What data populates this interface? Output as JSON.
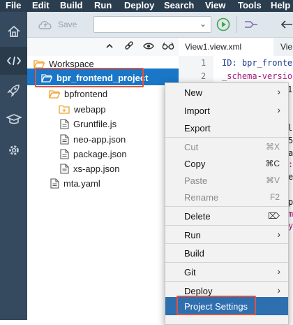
{
  "menubar": {
    "items": [
      "File",
      "Edit",
      "Build",
      "Run",
      "Deploy",
      "Search",
      "View",
      "Tools",
      "Help"
    ]
  },
  "toolbar": {
    "save_label": "Save"
  },
  "tree": {
    "workspace": "Workspace",
    "project": "bpr_frontend_project",
    "folder": "bpfrontend",
    "webapp": "webapp",
    "files": [
      "Gruntfile.js",
      "neo-app.json",
      "package.json",
      "xs-app.json"
    ],
    "mta": "mta.yaml"
  },
  "editor": {
    "tabs": [
      "View1.view.xml",
      "Vie"
    ],
    "line_numbers": [
      "1",
      "2"
    ],
    "line1": "ID: bpr_fronte",
    "line2": "_schema-version",
    "fragments": [
      "1",
      "lo",
      "5",
      "a",
      ":",
      "e",
      "p",
      "m",
      "y"
    ]
  },
  "context_menu": {
    "items": [
      {
        "label": "New",
        "shortcut": "",
        "submenu": true,
        "disabled": false
      },
      {
        "label": "Import",
        "shortcut": "",
        "submenu": true,
        "disabled": false
      },
      {
        "label": "Export",
        "shortcut": "",
        "submenu": false,
        "disabled": false
      },
      {
        "label": "Cut",
        "shortcut": "⌘X",
        "submenu": false,
        "disabled": true
      },
      {
        "label": "Copy",
        "shortcut": "⌘C",
        "submenu": false,
        "disabled": false
      },
      {
        "label": "Paste",
        "shortcut": "⌘V",
        "submenu": false,
        "disabled": true
      },
      {
        "label": "Rename",
        "shortcut": "F2",
        "submenu": false,
        "disabled": true
      },
      {
        "label": "Delete",
        "shortcut": "⌦",
        "submenu": false,
        "disabled": false
      },
      {
        "label": "Run",
        "shortcut": "",
        "submenu": true,
        "disabled": false
      },
      {
        "label": "Build",
        "shortcut": "",
        "submenu": false,
        "disabled": false
      },
      {
        "label": "Git",
        "shortcut": "",
        "submenu": true,
        "disabled": false
      },
      {
        "label": "Deploy",
        "shortcut": "",
        "submenu": true,
        "disabled": false
      },
      {
        "label": "Project Settings",
        "shortcut": "",
        "submenu": false,
        "disabled": false,
        "selected": true
      }
    ],
    "submenu_glyph": "›"
  },
  "colors": {
    "menubar_bg": "#2b3e50",
    "activity_bg": "#354a5f",
    "selection_blue": "#1a76c6",
    "highlight_red": "#e0533f",
    "folder_orange": "#f0a12c",
    "menu_selected": "#2e6fb0"
  },
  "icons": [
    "home-icon",
    "code-icon",
    "rocket-icon",
    "graduation-cap-icon",
    "gear-icon",
    "cloud-save-icon",
    "run-icon",
    "chevron-up-icon",
    "link-icon",
    "eye-icon",
    "glasses-icon",
    "folder-icon",
    "file-icon"
  ]
}
